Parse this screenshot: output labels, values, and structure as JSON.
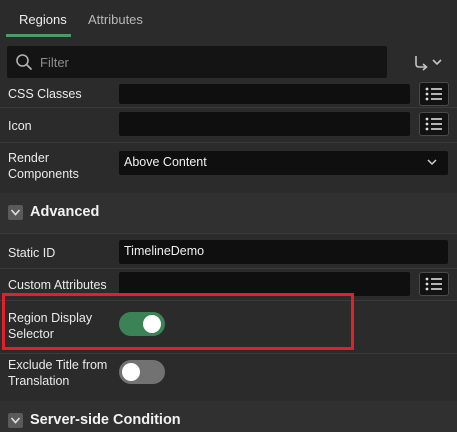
{
  "tabs": [
    {
      "label": "Regions",
      "active": true
    },
    {
      "label": "Attributes",
      "active": false
    }
  ],
  "filter": {
    "placeholder": "Filter"
  },
  "properties": {
    "css_classes": {
      "label": "CSS Classes",
      "value": ""
    },
    "icon": {
      "label": "Icon",
      "value": ""
    },
    "render_components": {
      "label_line1": "Render",
      "label_line2": "Components",
      "value": "Above Content"
    }
  },
  "advanced": {
    "title": "Advanced",
    "static_id": {
      "label": "Static ID",
      "value": "TimelineDemo"
    },
    "custom_attributes": {
      "label": "Custom Attributes",
      "value": ""
    },
    "region_display_selector": {
      "label_line1": "Region Display",
      "label_line2": "Selector",
      "checked": true
    },
    "exclude_title": {
      "label_line1": "Exclude Title from",
      "label_line2": "Translation",
      "checked": false
    }
  },
  "server_side": {
    "title": "Server-side Condition"
  },
  "colors": {
    "accent": "#4c9a67",
    "switch_on": "#3b8357",
    "switch_off": "#727272",
    "highlight": "#e0212b"
  }
}
